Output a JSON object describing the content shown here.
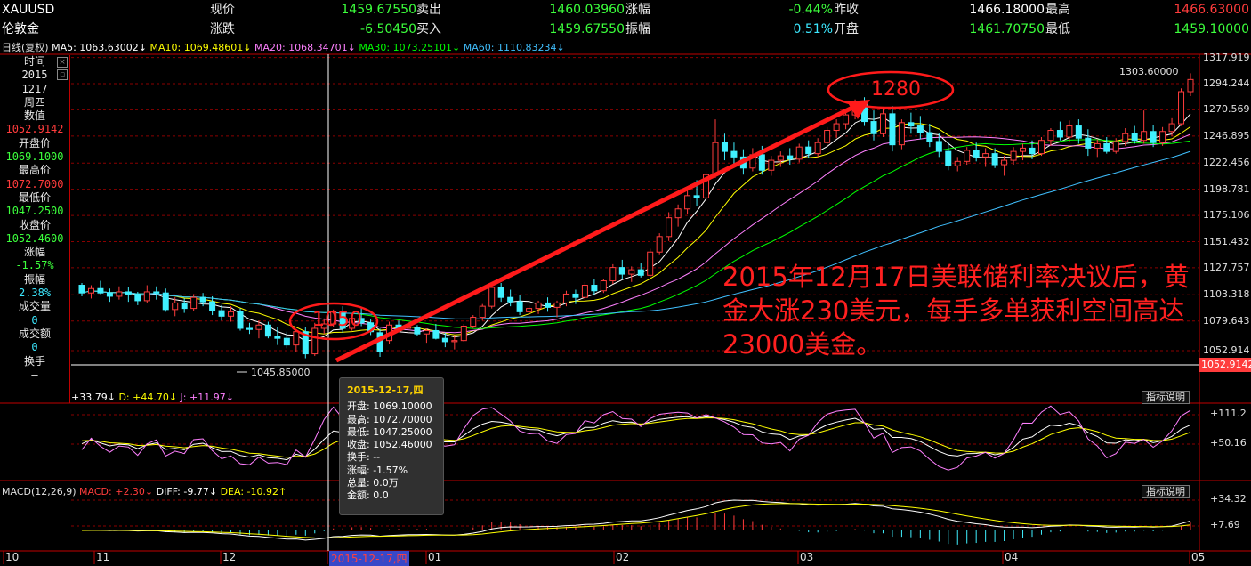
{
  "header": {
    "symbol": "XAUUSD",
    "name": "伦敦金",
    "row1": [
      {
        "label": "现价",
        "value": "1459.67550",
        "color": "g"
      },
      {
        "label": "卖出",
        "value": "1460.03960",
        "color": "g"
      },
      {
        "label": "涨幅",
        "value": "-0.44%",
        "color": "g"
      },
      {
        "label": "昨收",
        "value": "1466.18000",
        "color": "w"
      },
      {
        "label": "最高",
        "value": "1466.63000",
        "color": "r"
      }
    ],
    "row2": [
      {
        "label": "涨跌",
        "value": "-6.50450",
        "color": "g"
      },
      {
        "label": "买入",
        "value": "1459.67550",
        "color": "g"
      },
      {
        "label": "振幅",
        "value": "0.51%",
        "color": "c"
      },
      {
        "label": "开盘",
        "value": "1461.70750",
        "color": "g"
      },
      {
        "label": "最低",
        "value": "1459.10000",
        "color": "g"
      }
    ]
  },
  "ma_line": {
    "period": "日线(复权)",
    "ma5": "MA5: 1063.63002↓",
    "ma10": "MA10: 1069.48601↓",
    "ma20": "MA20: 1068.34701↓",
    "ma30": "MA30: 1073.25101↓",
    "ma60": "MA60: 1110.83234↓"
  },
  "side_panel": {
    "items": [
      {
        "text": "时间",
        "color": "#e8e8e8"
      },
      {
        "text": "2015",
        "color": "#e8e8e8"
      },
      {
        "text": "1217",
        "color": "#e8e8e8"
      },
      {
        "text": "周四",
        "color": "#e8e8e8"
      },
      {
        "text": "数值",
        "color": "#e8e8e8"
      },
      {
        "text": "1052.9142",
        "color": "#ff3c3c"
      },
      {
        "text": "开盘价",
        "color": "#e8e8e8"
      },
      {
        "text": "1069.1000",
        "color": "#3cff3c"
      },
      {
        "text": "最高价",
        "color": "#e8e8e8"
      },
      {
        "text": "1072.7000",
        "color": "#ff3c3c"
      },
      {
        "text": "最低价",
        "color": "#e8e8e8"
      },
      {
        "text": "1047.2500",
        "color": "#3cff3c"
      },
      {
        "text": "收盘价",
        "color": "#e8e8e8"
      },
      {
        "text": "1052.4600",
        "color": "#3cff3c"
      },
      {
        "text": "涨幅",
        "color": "#e8e8e8"
      },
      {
        "text": "-1.57%",
        "color": "#3cff3c"
      },
      {
        "text": "振幅",
        "color": "#e8e8e8"
      },
      {
        "text": "2.38%",
        "color": "#3ce8ff"
      },
      {
        "text": "成交量",
        "color": "#e8e8e8"
      },
      {
        "text": "0",
        "color": "#3ce8ff"
      },
      {
        "text": "成交额",
        "color": "#e8e8e8"
      },
      {
        "text": "0",
        "color": "#3ce8ff"
      },
      {
        "text": "换手",
        "color": "#e8e8e8"
      },
      {
        "text": "—",
        "color": "#e8e8e8"
      }
    ]
  },
  "kdj_line": {
    "k": "+33.79↓",
    "d": "D: +44.70↓",
    "j": "J: +11.97↓"
  },
  "macd_line": {
    "name": "MACD(12,26,9)",
    "macd": "MACD: +2.30↓",
    "diff": "DIFF: -9.77↓",
    "dea": "DEA: -10.92↑"
  },
  "indicator_button": "指标说明",
  "tooltip": {
    "date": "2015-12-17,四",
    "rows": [
      "开盘: 1069.10000",
      "最高: 1072.70000",
      "最低: 1047.25000",
      "收盘: 1052.46000",
      "换手: --",
      "涨幅: -1.57%",
      "总量: 0.0万",
      "金额: 0.0"
    ]
  },
  "annotation": {
    "low_label": "1050",
    "high_label": "1280",
    "lines": [
      "2015年12月17日美联储利率决议后，黄",
      "金大涨230美元，每手多单获利空间高达",
      "23000美金。"
    ]
  },
  "price_labels": {
    "low": "1045.85000",
    "high": "1303.60000",
    "current_marker": "1052.9142"
  },
  "colors": {
    "up": "#ff3c3c",
    "down": "#40f0ff",
    "grid": "#8b0000",
    "ma5": "#ffffff",
    "ma10": "#ffff00",
    "ma20": "#ff80ff",
    "ma30": "#00ff00",
    "ma60": "#40c0ff",
    "arrow": "#ff1a1a"
  },
  "chart_data": {
    "type": "candlestick",
    "y_axis_ticks": [
      "1317.919",
      "1294.244",
      "1270.569",
      "1246.895",
      "1222.456",
      "1198.781",
      "1175.106",
      "1151.432",
      "1127.757",
      "1103.318",
      "1079.643",
      "1052.914"
    ],
    "x_axis_ticks": [
      "10",
      "11",
      "12",
      "2015-12-17,四",
      "01",
      "02",
      "03",
      "04",
      "05"
    ],
    "kdj_ticks": [
      "+111.2",
      "+50.16"
    ],
    "macd_ticks": [
      "+34.32",
      "+7.69"
    ],
    "ylim": [
      1040,
      1320
    ],
    "candles": [
      [
        1112.0,
        1114.0,
        1102.0,
        1105.0
      ],
      [
        1105.0,
        1112.0,
        1100.0,
        1109.0
      ],
      [
        1109.0,
        1116.0,
        1104.0,
        1105.0
      ],
      [
        1105.0,
        1109.0,
        1097.0,
        1102.0
      ],
      [
        1102.0,
        1111.0,
        1099.0,
        1106.0
      ],
      [
        1106.0,
        1110.0,
        1097.0,
        1104.0
      ],
      [
        1104.0,
        1106.0,
        1094.0,
        1098.0
      ],
      [
        1098.0,
        1112.0,
        1096.0,
        1106.0
      ],
      [
        1106.0,
        1111.0,
        1099.0,
        1105.0
      ],
      [
        1105.0,
        1109.0,
        1088.0,
        1090.0
      ],
      [
        1090.0,
        1101.0,
        1084.0,
        1096.0
      ],
      [
        1096.0,
        1100.0,
        1087.0,
        1091.0
      ],
      [
        1091.0,
        1104.0,
        1089.0,
        1101.0
      ],
      [
        1101.0,
        1105.0,
        1093.0,
        1097.0
      ],
      [
        1097.0,
        1102.0,
        1085.0,
        1089.0
      ],
      [
        1089.0,
        1094.0,
        1080.0,
        1084.0
      ],
      [
        1084.0,
        1093.0,
        1079.0,
        1088.0
      ],
      [
        1088.0,
        1091.0,
        1071.0,
        1073.0
      ],
      [
        1073.0,
        1078.0,
        1068.0,
        1072.0
      ],
      [
        1072.0,
        1080.0,
        1064.0,
        1076.0
      ],
      [
        1076.0,
        1079.0,
        1064.0,
        1066.0
      ],
      [
        1066.0,
        1074.0,
        1058.0,
        1064.0
      ],
      [
        1064.0,
        1070.0,
        1055.0,
        1058.0
      ],
      [
        1058.0,
        1072.0,
        1052.0,
        1070.0
      ],
      [
        1070.0,
        1074.0,
        1046.0,
        1050.0
      ],
      [
        1050.0,
        1078.0,
        1048.0,
        1073.0
      ],
      [
        1073.0,
        1082.0,
        1068.0,
        1077.0
      ],
      [
        1077.0,
        1090.0,
        1074.0,
        1088.0
      ],
      [
        1088.0,
        1093.0,
        1069.0,
        1073.0
      ],
      [
        1073.0,
        1085.0,
        1071.0,
        1082.0
      ],
      [
        1082.0,
        1092.0,
        1075.0,
        1078.0
      ],
      [
        1078.0,
        1081.0,
        1067.0,
        1070.0
      ],
      [
        1069.1,
        1072.7,
        1047.25,
        1052.46
      ],
      [
        1062.0,
        1079.0,
        1059.0,
        1076.0
      ],
      [
        1076.0,
        1080.0,
        1070.0,
        1073.0
      ],
      [
        1073.0,
        1078.0,
        1068.0,
        1074.0
      ],
      [
        1074.0,
        1076.0,
        1066.0,
        1068.0
      ],
      [
        1068.0,
        1073.0,
        1060.0,
        1071.0
      ],
      [
        1071.0,
        1077.0,
        1063.0,
        1064.0
      ],
      [
        1064.0,
        1069.0,
        1056.0,
        1061.0
      ],
      [
        1061.0,
        1067.0,
        1054.0,
        1062.0
      ],
      [
        1062.0,
        1077.0,
        1061.0,
        1075.0
      ],
      [
        1075.0,
        1085.0,
        1073.0,
        1083.0
      ],
      [
        1083.0,
        1095.0,
        1080.0,
        1093.0
      ],
      [
        1093.0,
        1114.0,
        1091.0,
        1110.0
      ],
      [
        1110.0,
        1114.0,
        1097.0,
        1101.0
      ],
      [
        1101.0,
        1108.0,
        1093.0,
        1097.0
      ],
      [
        1097.0,
        1103.0,
        1085.0,
        1088.0
      ],
      [
        1088.0,
        1094.0,
        1079.0,
        1091.0
      ],
      [
        1091.0,
        1098.0,
        1086.0,
        1096.0
      ],
      [
        1096.0,
        1101.0,
        1088.0,
        1092.0
      ],
      [
        1092.0,
        1098.0,
        1083.0,
        1096.0
      ],
      [
        1096.0,
        1107.0,
        1093.0,
        1104.0
      ],
      [
        1104.0,
        1108.0,
        1095.0,
        1101.0
      ],
      [
        1101.0,
        1115.0,
        1098.0,
        1112.0
      ],
      [
        1112.0,
        1118.0,
        1103.0,
        1107.0
      ],
      [
        1107.0,
        1118.0,
        1105.0,
        1116.0
      ],
      [
        1116.0,
        1131.0,
        1113.0,
        1128.0
      ],
      [
        1128.0,
        1135.0,
        1118.0,
        1122.0
      ],
      [
        1122.0,
        1129.0,
        1115.0,
        1126.0
      ],
      [
        1126.0,
        1132.0,
        1119.0,
        1121.0
      ],
      [
        1121.0,
        1145.0,
        1119.0,
        1142.0
      ],
      [
        1142.0,
        1159.0,
        1140.0,
        1156.0
      ],
      [
        1156.0,
        1178.0,
        1152.0,
        1173.0
      ],
      [
        1173.0,
        1185.0,
        1165.0,
        1181.0
      ],
      [
        1181.0,
        1199.0,
        1176.0,
        1193.0
      ],
      [
        1193.0,
        1207.0,
        1184.0,
        1191.0
      ],
      [
        1191.0,
        1215.0,
        1188.0,
        1212.0
      ],
      [
        1212.0,
        1262.0,
        1209.0,
        1241.0
      ],
      [
        1241.0,
        1249.0,
        1225.0,
        1233.0
      ],
      [
        1233.0,
        1241.0,
        1221.0,
        1228.0
      ],
      [
        1228.0,
        1235.0,
        1212.0,
        1218.0
      ],
      [
        1218.0,
        1236.0,
        1215.0,
        1230.0
      ],
      [
        1230.0,
        1238.0,
        1212.0,
        1216.0
      ],
      [
        1216.0,
        1229.0,
        1211.0,
        1225.0
      ],
      [
        1225.0,
        1233.0,
        1219.0,
        1229.0
      ],
      [
        1229.0,
        1236.0,
        1221.0,
        1226.0
      ],
      [
        1226.0,
        1240.0,
        1223.0,
        1237.0
      ],
      [
        1237.0,
        1243.0,
        1227.0,
        1231.0
      ],
      [
        1231.0,
        1245.0,
        1228.0,
        1241.0
      ],
      [
        1241.0,
        1255.0,
        1238.0,
        1252.0
      ],
      [
        1252.0,
        1262.0,
        1245.0,
        1258.0
      ],
      [
        1258.0,
        1270.0,
        1253.0,
        1266.0
      ],
      [
        1266.0,
        1280.0,
        1262.0,
        1277.0
      ],
      [
        1277.0,
        1282.0,
        1256.0,
        1260.0
      ],
      [
        1260.0,
        1270.0,
        1243.0,
        1249.0
      ],
      [
        1249.0,
        1272.0,
        1246.0,
        1267.0
      ],
      [
        1267.0,
        1274.0,
        1233.0,
        1239.0
      ],
      [
        1239.0,
        1262.0,
        1235.0,
        1259.0
      ],
      [
        1259.0,
        1268.0,
        1249.0,
        1256.0
      ],
      [
        1256.0,
        1265.0,
        1244.0,
        1250.0
      ],
      [
        1250.0,
        1258.0,
        1237.0,
        1242.0
      ],
      [
        1242.0,
        1250.0,
        1228.0,
        1233.0
      ],
      [
        1233.0,
        1242.0,
        1216.0,
        1220.0
      ],
      [
        1220.0,
        1228.0,
        1215.0,
        1224.0
      ],
      [
        1224.0,
        1237.0,
        1221.0,
        1234.0
      ],
      [
        1234.0,
        1241.0,
        1224.0,
        1228.0
      ],
      [
        1228.0,
        1236.0,
        1219.0,
        1231.0
      ],
      [
        1231.0,
        1236.0,
        1218.0,
        1221.0
      ],
      [
        1221.0,
        1229.0,
        1211.0,
        1225.0
      ],
      [
        1225.0,
        1237.0,
        1221.0,
        1233.0
      ],
      [
        1233.0,
        1240.0,
        1225.0,
        1236.0
      ],
      [
        1236.0,
        1243.0,
        1226.0,
        1231.0
      ],
      [
        1231.0,
        1246.0,
        1229.0,
        1243.0
      ],
      [
        1243.0,
        1254.0,
        1238.0,
        1252.0
      ],
      [
        1252.0,
        1260.0,
        1243.0,
        1246.0
      ],
      [
        1246.0,
        1261.0,
        1242.0,
        1256.0
      ],
      [
        1256.0,
        1262.0,
        1240.0,
        1245.0
      ],
      [
        1245.0,
        1253.0,
        1229.0,
        1236.0
      ],
      [
        1236.0,
        1244.0,
        1228.0,
        1240.0
      ],
      [
        1240.0,
        1246.0,
        1231.0,
        1233.0
      ],
      [
        1233.0,
        1245.0,
        1231.0,
        1242.0
      ],
      [
        1242.0,
        1254.0,
        1238.0,
        1249.0
      ],
      [
        1249.0,
        1256.0,
        1240.0,
        1243.0
      ],
      [
        1243.0,
        1270.0,
        1240.0,
        1251.0
      ],
      [
        1251.0,
        1257.0,
        1237.0,
        1241.0
      ],
      [
        1241.0,
        1255.0,
        1238.0,
        1251.0
      ],
      [
        1251.0,
        1263.0,
        1247.0,
        1258.0
      ],
      [
        1258.0,
        1290.0,
        1256.0,
        1287.0
      ],
      [
        1287.0,
        1303.6,
        1283.0,
        1298.0
      ]
    ]
  }
}
